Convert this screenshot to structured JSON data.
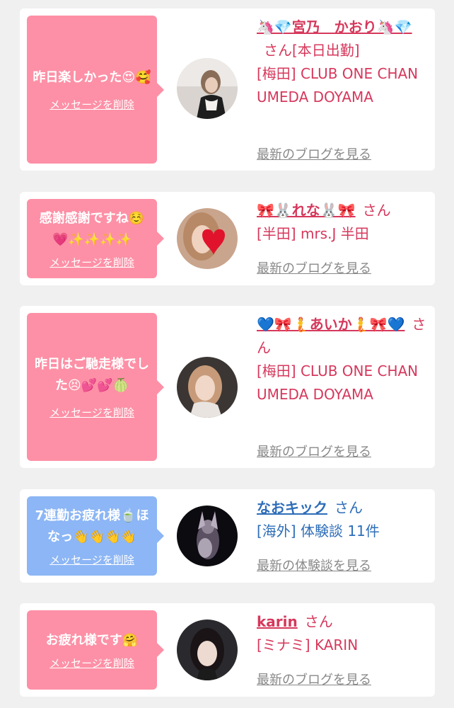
{
  "cards": [
    {
      "message": "昨日楽しかった😍🥰",
      "delete_label": "メッセージを削除",
      "name": "🦄💎宮乃　かおり🦄💎",
      "san": "さん[本日出勤]",
      "shop": "[梅田] CLUB ONE CHAN UMEDA DOYAMA",
      "link": "最新のブログを見る",
      "theme": "pink"
    },
    {
      "message": "感謝感謝ですね☺️💗✨✨✨✨",
      "delete_label": "メッセージを削除",
      "name": "🎀🐰れな🐰🎀",
      "san": "さん",
      "shop": "[半田] mrs.J 半田",
      "link": "最新のブログを見る",
      "theme": "pink"
    },
    {
      "message": "昨日はご馳走様でした😣💕💕🍈",
      "delete_label": "メッセージを削除",
      "name": "💙🎀🧜あいか🧜🎀💙",
      "san": "さん",
      "shop": "[梅田] CLUB ONE CHAN UMEDA DOYAMA",
      "link": "最新のブログを見る",
      "theme": "pink"
    },
    {
      "message": "7連勤お疲れ様🍵ほなっ👋👋👋👋",
      "delete_label": "メッセージを削除",
      "name": "なおキック",
      "san": "さん",
      "shop": "[海外] 体験談 11件",
      "link": "最新の体験談を見る",
      "theme": "blue"
    },
    {
      "message": "お疲れ様です🤗",
      "delete_label": "メッセージを削除",
      "name": "karin",
      "san": "さん",
      "shop": "[ミナミ] KARIN",
      "link": "最新のブログを見る",
      "theme": "pink"
    }
  ],
  "colors": {
    "bubble_pink": "#fd90a6",
    "bubble_blue": "#8cb6f5",
    "name_pink": "#d6385c",
    "name_blue": "#2e6db8",
    "link_gray": "#888888"
  }
}
